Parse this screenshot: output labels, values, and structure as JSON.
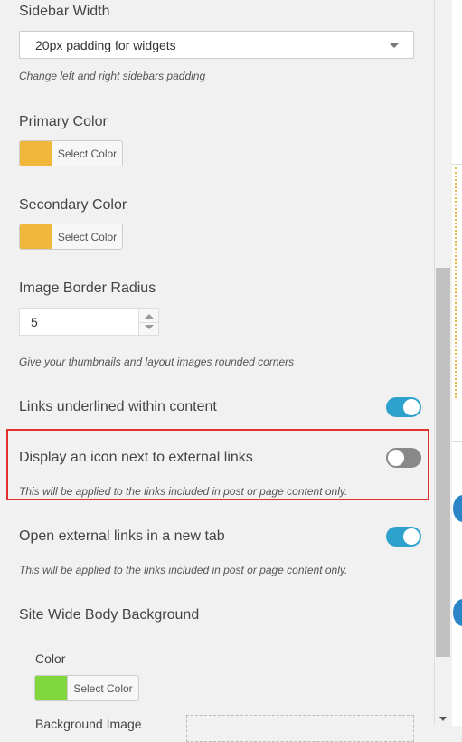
{
  "sidebar_width": {
    "label": "Sidebar Width",
    "selected": "20px padding for widgets",
    "description": "Change left and right sidebars padding"
  },
  "primary_color": {
    "label": "Primary Color",
    "button_label": "Select Color",
    "value": "#f0b73b"
  },
  "secondary_color": {
    "label": "Secondary Color",
    "button_label": "Select Color",
    "value": "#f0b73b"
  },
  "image_border_radius": {
    "label": "Image Border Radius",
    "value": "5",
    "description": "Give your thumbnails and layout images rounded corners"
  },
  "links_underlined": {
    "label": "Links underlined within content",
    "enabled": true
  },
  "external_icon": {
    "label": "Display an icon next to external links",
    "enabled": false,
    "description": "This will be applied to the links included in post or page content only."
  },
  "external_new_tab": {
    "label": "Open external links in a new tab",
    "enabled": true,
    "description": "This will be applied to the links included in post or page content only."
  },
  "body_background": {
    "label": "Site Wide Body Background",
    "color_label": "Color",
    "color_button_label": "Select Color",
    "color_value": "#80d83e",
    "image_label": "Background Image"
  },
  "colors": {
    "accent": "#2ea2cc",
    "highlight": "#e03131",
    "toggle_off": "#888888"
  }
}
